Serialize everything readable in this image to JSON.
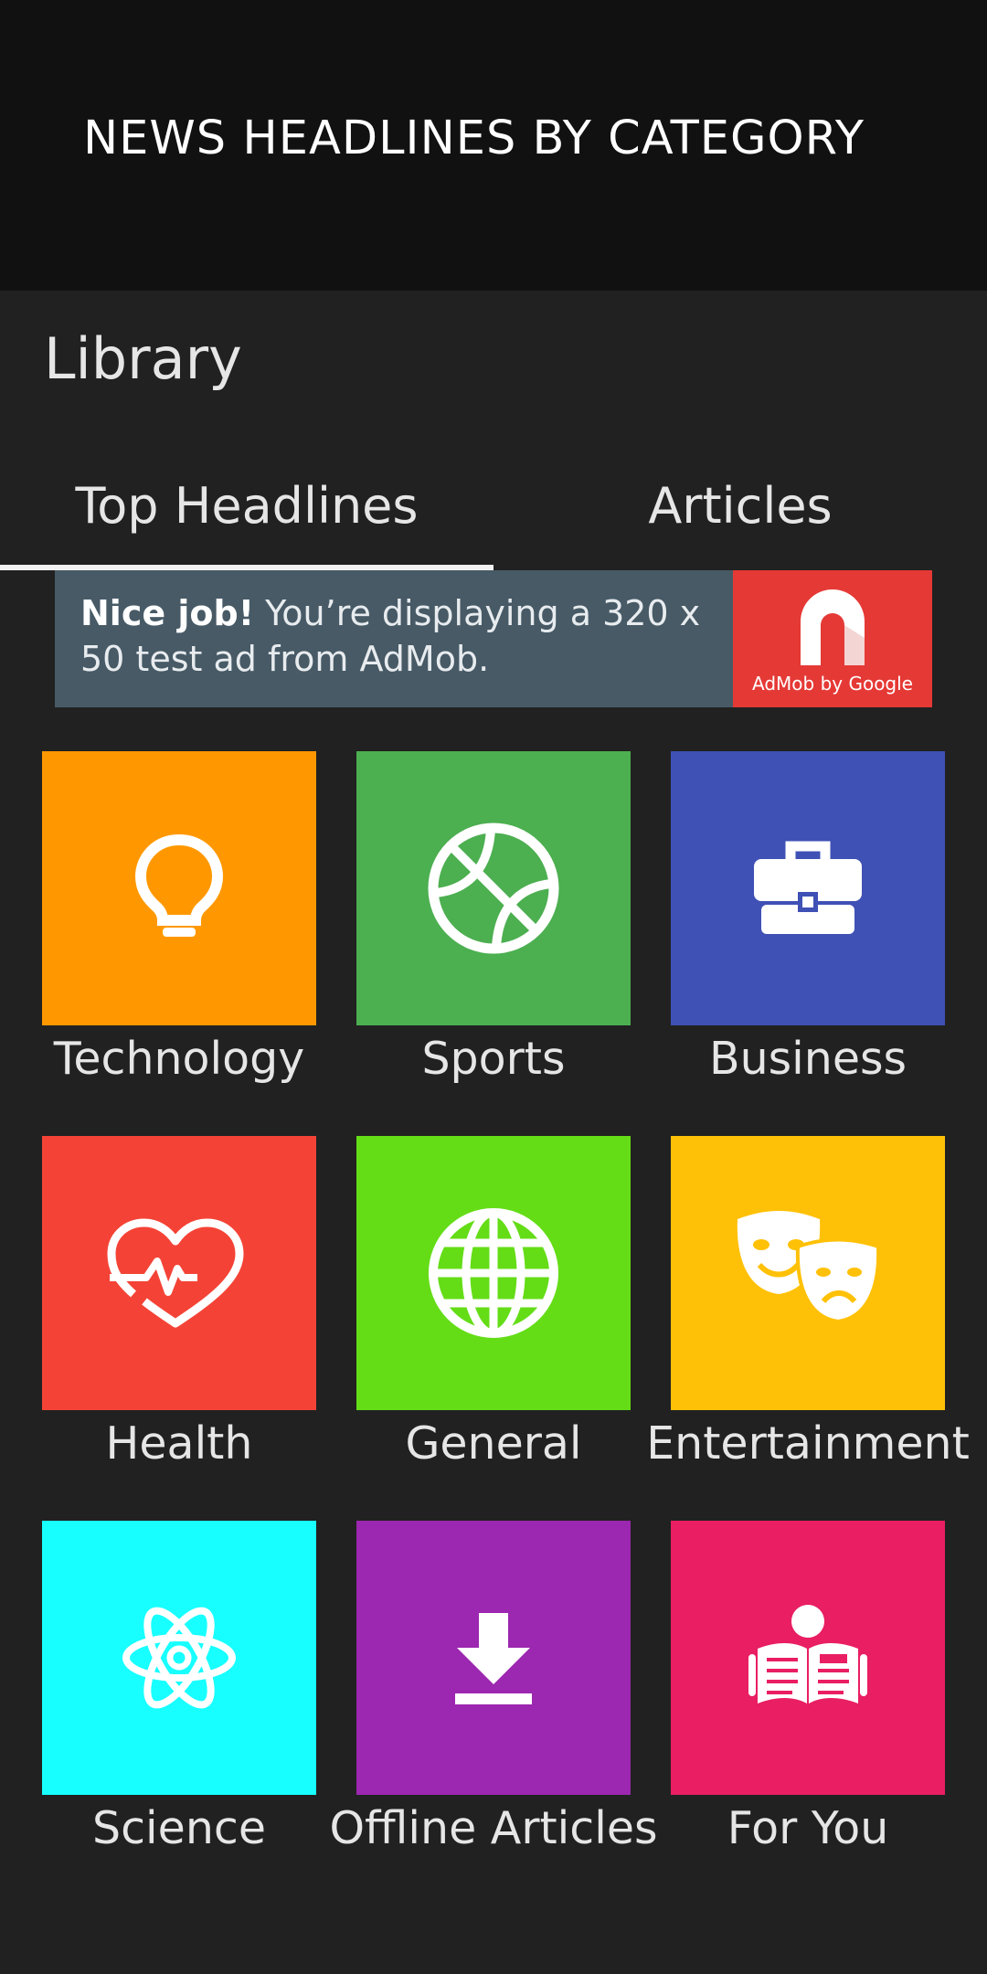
{
  "app_bar": {
    "title": "NEWS HEADLINES BY CATEGORY"
  },
  "library": {
    "title": "Library"
  },
  "tabs": [
    {
      "label": "Top Headlines",
      "selected": true
    },
    {
      "label": "Articles",
      "selected": false
    }
  ],
  "ad": {
    "bold_text": "Nice job!",
    "text": " You’re displaying a 320 x 50 test ad from AdMob.",
    "logo_text": "AdMob by Google"
  },
  "categories": [
    {
      "label": "Technology",
      "icon": "lightbulb-icon",
      "color": "#FF9800"
    },
    {
      "label": "Sports",
      "icon": "basketball-icon",
      "color": "#4CAF50"
    },
    {
      "label": "Business",
      "icon": "briefcase-icon",
      "color": "#3F51B5"
    },
    {
      "label": "Health",
      "icon": "heartbeat-icon",
      "color": "#F44336"
    },
    {
      "label": "General",
      "icon": "globe-icon",
      "color": "#64DD17"
    },
    {
      "label": "Entertainment",
      "icon": "theater-masks-icon",
      "color": "#FFC107"
    },
    {
      "label": "Science",
      "icon": "atom-icon",
      "color": "#18FFFF"
    },
    {
      "label": "Offline Articles",
      "icon": "download-icon",
      "color": "#9C27B0"
    },
    {
      "label": "For You",
      "icon": "reading-person-icon",
      "color": "#E91E63"
    }
  ]
}
